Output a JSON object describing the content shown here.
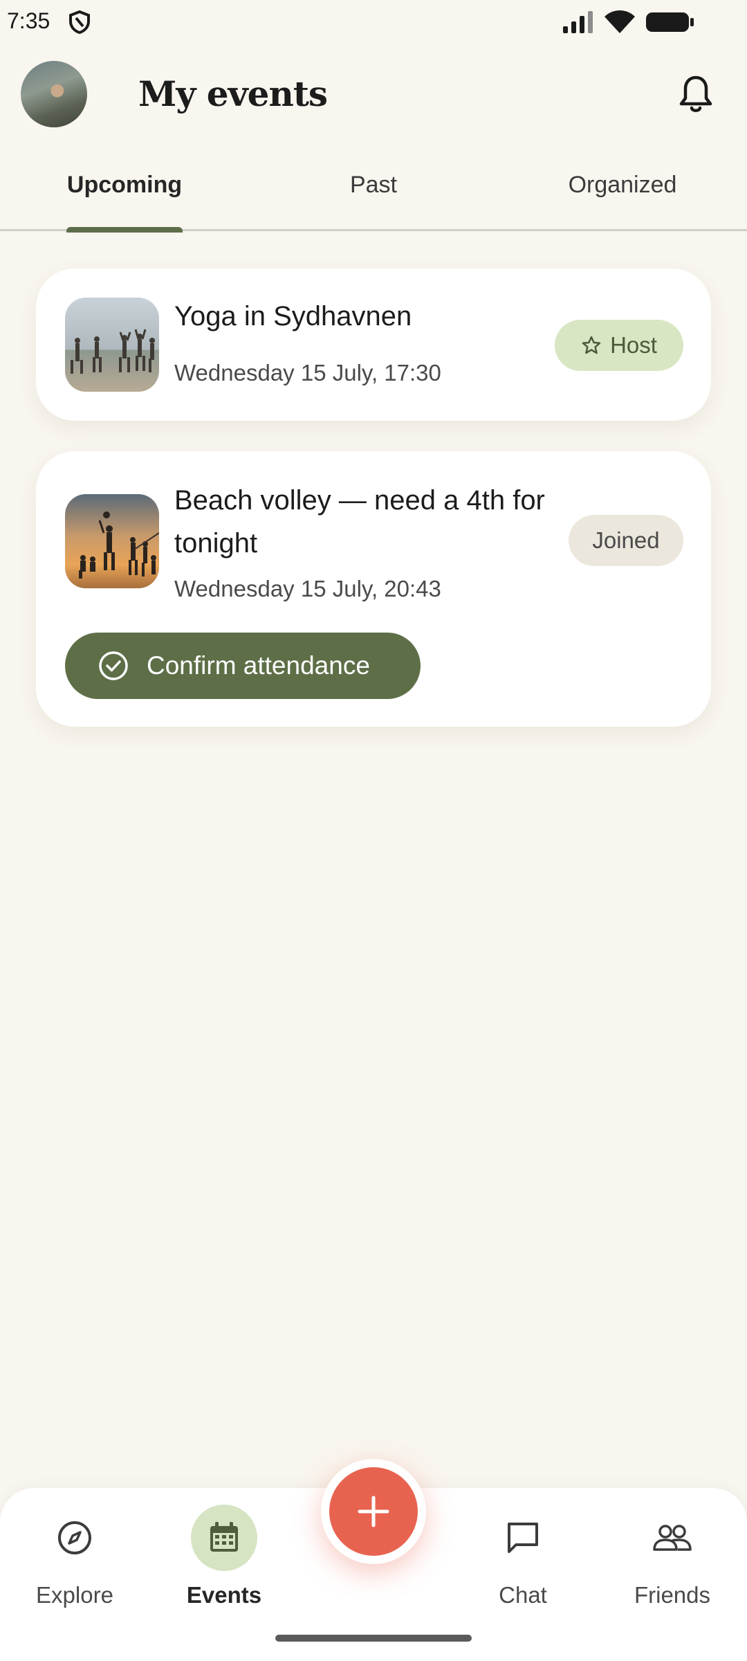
{
  "status_bar": {
    "time": "7:35"
  },
  "header": {
    "title": "My events"
  },
  "tabs": [
    {
      "label": "Upcoming",
      "active": true
    },
    {
      "label": "Past",
      "active": false
    },
    {
      "label": "Organized",
      "active": false
    }
  ],
  "events": [
    {
      "title": "Yoga in Sydhavnen",
      "date": "Wednesday 15 July, 17:30",
      "badge": "Host",
      "badge_icon": "star-icon"
    },
    {
      "title": "Beach volley — need a 4th for tonight",
      "date": "Wednesday 15 July, 20:43",
      "badge": "Joined",
      "action_label": "Confirm attendance",
      "action_icon": "check-circle-icon"
    }
  ],
  "bottom_nav": {
    "items": [
      {
        "label": "Explore",
        "icon": "compass-icon"
      },
      {
        "label": "Events",
        "icon": "calendar-icon",
        "active": true
      },
      {
        "label": "Chat",
        "icon": "chat-icon"
      },
      {
        "label": "Friends",
        "icon": "friends-icon"
      }
    ],
    "fab_icon": "plus-icon"
  },
  "colors": {
    "background": "#f9f6ef",
    "accent_green": "#5e6f48",
    "host_badge": "#d8e6c4",
    "joined_badge": "#ece7dd",
    "fab": "#e8634f"
  }
}
